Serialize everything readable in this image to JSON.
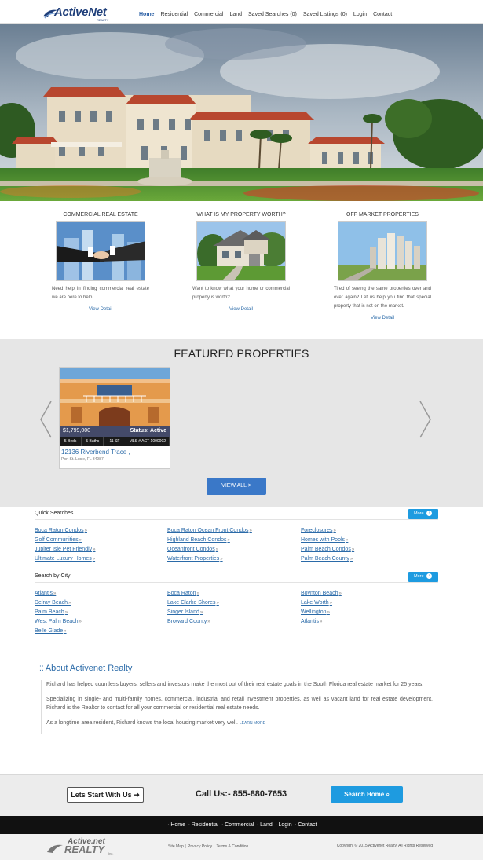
{
  "header": {
    "logo_text": "ActiveNet",
    "logo_sub": "REALTY",
    "nav": [
      {
        "label": "Home",
        "active": true
      },
      {
        "label": "Residential"
      },
      {
        "label": "Commercial"
      },
      {
        "label": "Land"
      },
      {
        "label": "Saved Searches (0)"
      },
      {
        "label": "Saved Listings (0)"
      },
      {
        "label": "Login"
      },
      {
        "label": "Contact"
      }
    ]
  },
  "columns": [
    {
      "title": "COMMERCIAL REAL ESTATE",
      "desc": "Need help in finding commercial real estate we are here to help.",
      "more": "View Detail"
    },
    {
      "title": "WHAT IS MY PROPERTY WORTH?",
      "desc": "Want to know what your home or commercial property is worth?",
      "more": "View Detail"
    },
    {
      "title": "OFF MARKET PROPERTIES",
      "desc": "Tired of seeing the same properties over and over again? Let us help you find that special property that is not on the market.",
      "more": "View Detail"
    }
  ],
  "featured": {
    "title": "FEATURED PROPERTIES",
    "card": {
      "price": "$1,799,000",
      "status": "Status: Active",
      "beds": "5 Beds",
      "baths": "5 Baths",
      "sqft": "11 SF",
      "mls": "MLS # ACT-1000002",
      "address": "12136 Riverbend Trace ,",
      "city": "Port St. Lucie, FL 34987"
    },
    "view_all": "VIEW ALL >"
  },
  "quick_searches": {
    "heading": "Quick Searches",
    "more": "More",
    "items": [
      "Boca Raton Condos",
      "Boca Raton Ocean Front Condos",
      "Foreclosures",
      "Golf Communities",
      "Highland Beach Condos",
      "Homes with Pools",
      "Jupiter Isle Pet Friendly",
      "Oceanfront Condos",
      "Palm Beach Condos",
      "Ultimate Luxury Homes",
      "Waterfront Properties",
      "Palm Beach County"
    ]
  },
  "search_by_city": {
    "heading": "Search by City",
    "more": "More",
    "items": [
      "Atlantis",
      "Boca Raton",
      "Boynton Beach",
      "Delray Beach",
      "Lake Clarke Shores",
      "Lake Worth",
      "Palm Beach",
      "Singer Island",
      "Wellington",
      "West Palm Beach",
      "Broward County",
      "Atlantis",
      "Belle Glade"
    ]
  },
  "about": {
    "title": "About Activenet Realty",
    "p1": "Richard has helped countless buyers, sellers and investors make the most out of their real estate goals in the South Florida real estate market for 25 years.",
    "p2": "Specializing in single- and multi-family homes, commercial, industrial and retail investment properties, as well as vacant land for real estate development, Richard is the Realtor to contact for all your commercial or residential real estate needs.",
    "p3": "As a longtime area resident, Richard knows the local housing market very well.",
    "learn_more": "LEARN MORE"
  },
  "cta": {
    "start": "Lets Start With Us",
    "call": "Call Us:- 855-880-7653",
    "search": "Search Home"
  },
  "footer": {
    "nav": [
      "Home",
      "Residential",
      "Commercial",
      "Land",
      "Login",
      "Contact"
    ],
    "logo_line1": "Active.net",
    "logo_line2": "REALTY",
    "logo_line3": "Inc.",
    "links": [
      "Site Map",
      "Privacy Policy",
      "Terms & Condition"
    ],
    "copyright": "Copyright © 2015 Activenet Realty. All Rights Reserved"
  }
}
